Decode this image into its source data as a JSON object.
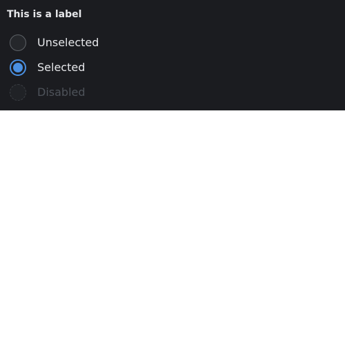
{
  "group": {
    "label": "This is a label"
  },
  "options": [
    {
      "label": "Unselected",
      "state": "unselected"
    },
    {
      "label": "Selected",
      "state": "selected"
    },
    {
      "label": "Disabled",
      "state": "disabled"
    }
  ],
  "colors": {
    "panel_background": "#1b1c20",
    "accent": "#4a90e2",
    "text": "#e6e7ea",
    "disabled_text": "#4e535a"
  }
}
